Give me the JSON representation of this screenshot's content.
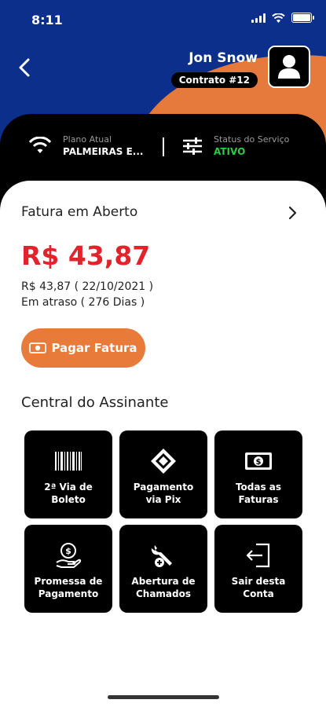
{
  "status_bar": {
    "time": "8:11"
  },
  "header": {
    "user_name": "Jon Snow",
    "contract": "Contrato  #12"
  },
  "plan": {
    "label": "Plano Atual",
    "value": "PALMEIRAS E..."
  },
  "service_status": {
    "label": "Status do Serviço",
    "value": "ATIVO"
  },
  "invoice": {
    "title": "Fatura em Aberto",
    "amount": "R$ 43,87",
    "detail_line1": "R$ 43,87 ( 22/10/2021 )",
    "detail_line2": "Em atraso ( 276 Dias )",
    "pay_button": "Pagar Fatura"
  },
  "central": {
    "title": "Central do Assinante",
    "tiles": [
      {
        "line1": "2ª Via de",
        "line2": "Boleto",
        "icon": "barcode-icon"
      },
      {
        "line1": "Pagamento",
        "line2": "via Pix",
        "icon": "pix-icon"
      },
      {
        "line1": "Todas as",
        "line2": "Faturas",
        "icon": "money-icon"
      },
      {
        "line1": "Promessa de",
        "line2": "Pagamento",
        "icon": "hand-coin-icon"
      },
      {
        "line1": "Abertura de",
        "line2": "Chamados",
        "icon": "tools-icon"
      },
      {
        "line1": "Sair desta",
        "line2": "Conta",
        "icon": "logout-icon"
      }
    ]
  },
  "colors": {
    "header_blue": "#0d2f8c",
    "header_orange": "#e67a3c",
    "amount_red": "#e3232c",
    "status_green": "#2ecc40",
    "pay_button": "#e87a3a"
  }
}
